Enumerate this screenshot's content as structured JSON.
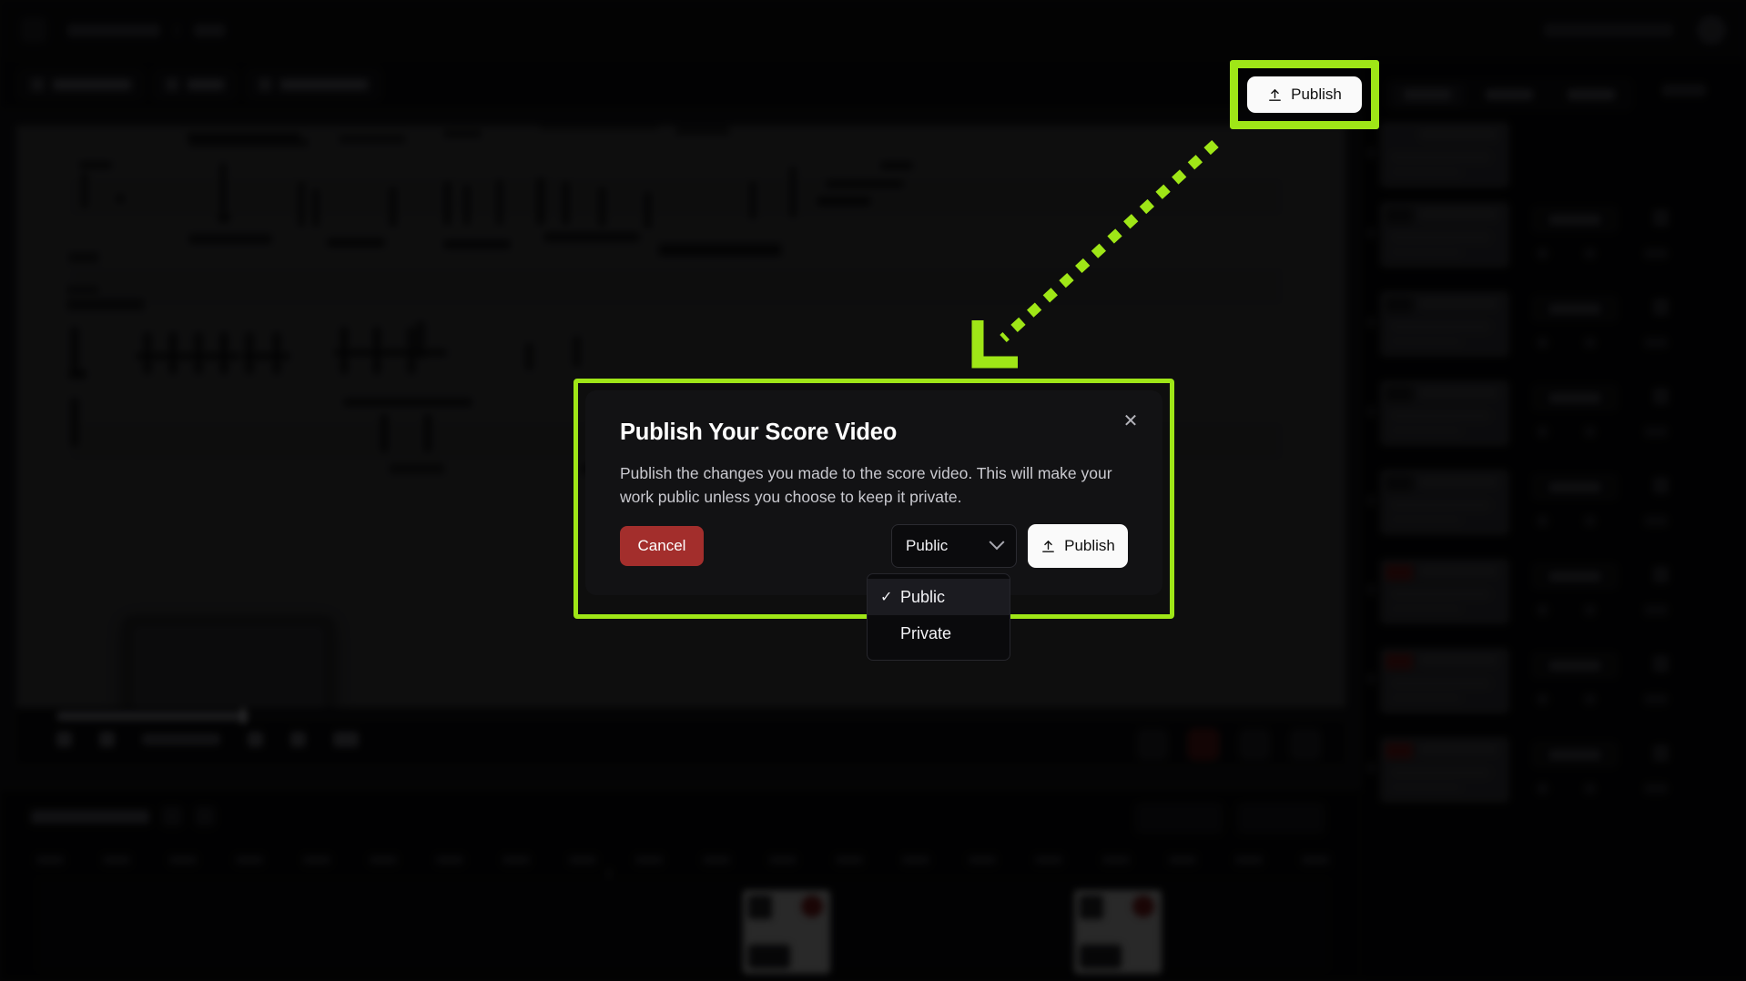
{
  "app": {
    "background_note": "Blurred score-video editor application behind a modal dialog"
  },
  "header": {
    "publish_button_label": "Publish",
    "publish_icon": "upload-icon"
  },
  "modal": {
    "title": "Publish Your Score Video",
    "body": "Publish the changes you made to the score video. This will make your work public unless you choose to keep it private.",
    "close_icon": "close-icon",
    "cancel_label": "Cancel",
    "publish_label": "Publish",
    "publish_icon": "upload-icon",
    "visibility": {
      "selected": "Public",
      "chevron_icon": "chevron-down-icon",
      "options": [
        {
          "label": "Public",
          "checked": true,
          "check_icon": "check-icon"
        },
        {
          "label": "Private",
          "checked": false,
          "check_icon": ""
        }
      ]
    }
  },
  "annotation": {
    "highlight_color": "#9fe617",
    "arrow_icon": "dashed-arrow-icon",
    "target": "publish-button"
  },
  "colors": {
    "accent_green": "#9fe617",
    "cancel_red": "#a32e2c",
    "publish_white": "#fafafa",
    "modal_bg": "#121214",
    "app_bg": "#0b0b0d"
  }
}
